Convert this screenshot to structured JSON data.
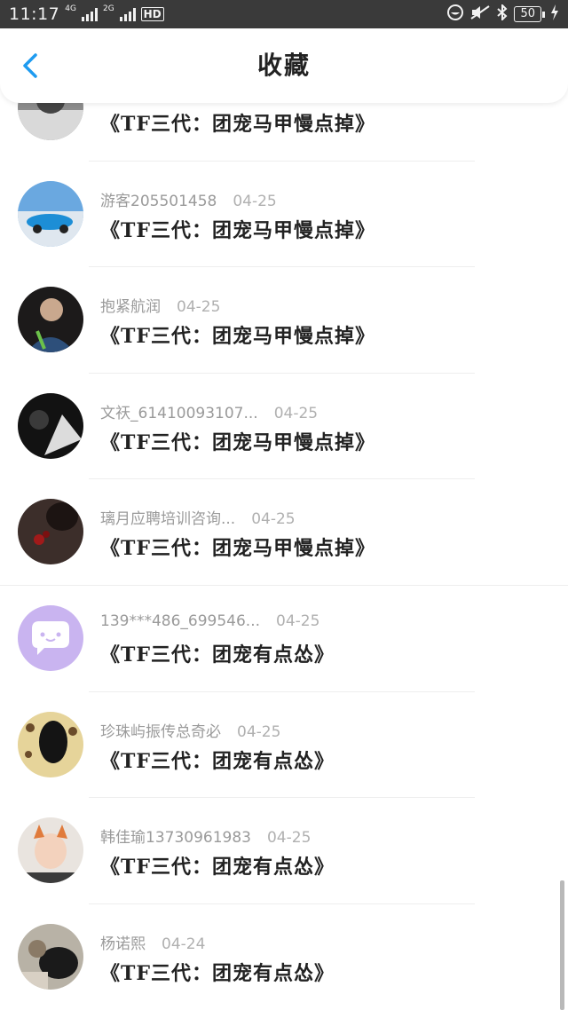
{
  "status_bar": {
    "time": "11:17",
    "sim1": "4G",
    "sim2": "2G",
    "hd": "HD",
    "battery": "50",
    "icons": [
      "wechat-icon",
      "mute-icon",
      "bluetooth-icon",
      "charging-icon"
    ]
  },
  "header": {
    "title": "收藏",
    "back_icon": "chevron-left-icon",
    "accent": "#1e9bf0"
  },
  "items": [
    {
      "user": "",
      "date": "",
      "title": "《TF三代：团宠马甲慢点掉》"
    },
    {
      "user": "游客205501458",
      "date": "04-25",
      "title": "《TF三代：团宠马甲慢点掉》"
    },
    {
      "user": "抱紧航润",
      "date": "04-25",
      "title": "《TF三代：团宠马甲慢点掉》"
    },
    {
      "user": "文祆_61410093107...",
      "date": "04-25",
      "title": "《TF三代：团宠马甲慢点掉》"
    },
    {
      "user": "璃月应聘培训咨询...",
      "date": "04-25",
      "title": "《TF三代：团宠马甲慢点掉》"
    },
    {
      "user": "139***486_699546...",
      "date": "04-25",
      "title": "《TF三代：团宠有点怂》"
    },
    {
      "user": "珍珠屿振传总奇必",
      "date": "04-25",
      "title": "《TF三代：团宠有点怂》"
    },
    {
      "user": "韩佳瑜13730961983",
      "date": "04-25",
      "title": "《TF三代：团宠有点怂》"
    },
    {
      "user": "杨诺熙",
      "date": "04-24",
      "title": "《TF三代：团宠有点怂》"
    }
  ]
}
